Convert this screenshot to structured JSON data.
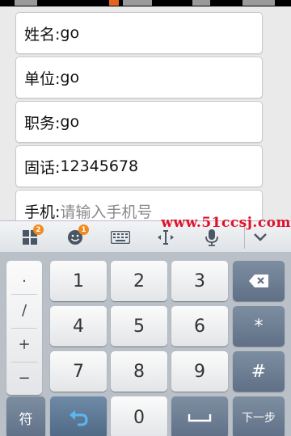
{
  "form": {
    "fields": [
      {
        "label": "姓名:",
        "value": "go",
        "placeholder": ""
      },
      {
        "label": "单位:",
        "value": "go",
        "placeholder": ""
      },
      {
        "label": "职务:",
        "value": "go",
        "placeholder": ""
      },
      {
        "label": "固话:",
        "value": "12345678",
        "placeholder": ""
      },
      {
        "label": "手机:",
        "value": "",
        "placeholder": "请输入手机号"
      }
    ]
  },
  "watermark": "www.51ccsj.com",
  "toolbar": {
    "icons": [
      "apps-icon",
      "emoji-icon",
      "keyboard-icon",
      "text-cursor-icon",
      "microphone-icon",
      "chevron-down-icon"
    ],
    "badges": {
      "apps": "2",
      "emoji": "1"
    }
  },
  "keyboard": {
    "symbols": [
      ".",
      "/",
      "+",
      "−"
    ],
    "digits": [
      "1",
      "2",
      "3",
      "4",
      "5",
      "6",
      "7",
      "8",
      "9",
      "0"
    ],
    "asterisk": "*",
    "hash": "#",
    "symbol_key": "符",
    "next_key": "下一步"
  },
  "colors": {
    "watermark": "#e0102a",
    "badge": "#f28a1d",
    "keyboard_bg": "#b9c0c8",
    "dark_key": "#6e7f94"
  }
}
